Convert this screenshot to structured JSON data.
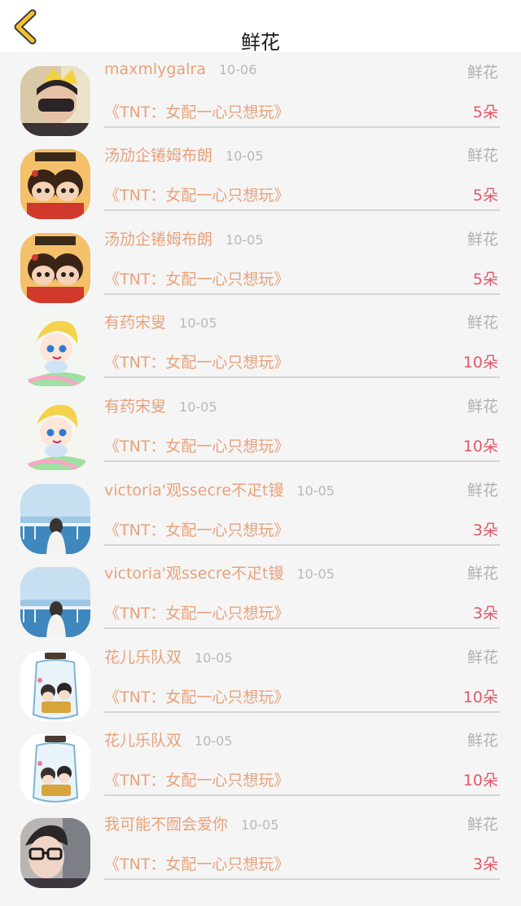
{
  "header": {
    "title": "鲜花"
  },
  "list": [
    {
      "user": "",
      "date": "",
      "gift": "",
      "book": "《TNT：女配一心只想玩》",
      "amount": "5朵",
      "avatar": "avatar-photo-dark"
    },
    {
      "user": "maxmlygalra",
      "date": "10-06",
      "gift": "鲜花",
      "book": "《TNT：女配一心只想玩》",
      "amount": "5朵",
      "avatar": "avatar-photo-crown"
    },
    {
      "user": "汤劢企锩姆布朗",
      "date": "10-05",
      "gift": "鲜花",
      "book": "《TNT：女配一心只想玩》",
      "amount": "5朵",
      "avatar": "avatar-twins-cartoon"
    },
    {
      "user": "汤劢企锩姆布朗",
      "date": "10-05",
      "gift": "鲜花",
      "book": "《TNT：女配一心只想玩》",
      "amount": "5朵",
      "avatar": "avatar-twins-cartoon"
    },
    {
      "user": "有药宋叟",
      "date": "10-05",
      "gift": "鲜花",
      "book": "《TNT：女配一心只想玩》",
      "amount": "10朵",
      "avatar": "avatar-anime-blonde"
    },
    {
      "user": "有药宋叟",
      "date": "10-05",
      "gift": "鲜花",
      "book": "《TNT：女配一心只想玩》",
      "amount": "10朵",
      "avatar": "avatar-anime-blonde"
    },
    {
      "user": "victoria'观ssecre不疋t镘",
      "date": "10-05",
      "gift": "鲜花",
      "book": "《TNT：女配一心只想玩》",
      "amount": "3朵",
      "avatar": "avatar-seaside-girl"
    },
    {
      "user": "victoria'观ssecre不疋t镘",
      "date": "10-05",
      "gift": "鲜花",
      "book": "《TNT：女配一心只想玩》",
      "amount": "3朵",
      "avatar": "avatar-seaside-girl"
    },
    {
      "user": "花儿乐队双",
      "date": "10-05",
      "gift": "鲜花",
      "book": "《TNT：女配一心只想玩》",
      "amount": "10朵",
      "avatar": "avatar-jar-couple"
    },
    {
      "user": "花儿乐队双",
      "date": "10-05",
      "gift": "鲜花",
      "book": "《TNT：女配一心只想玩》",
      "amount": "10朵",
      "avatar": "avatar-jar-couple"
    },
    {
      "user": "我可能不囫会爱你",
      "date": "10-05",
      "gift": "鲜花",
      "book": "《TNT：女配一心只想玩》",
      "amount": "3朵",
      "avatar": "avatar-glasses-boy"
    }
  ],
  "colors": {
    "accent": "#e8a27b",
    "amount": "#e0586a",
    "back": "#f2c12e"
  }
}
